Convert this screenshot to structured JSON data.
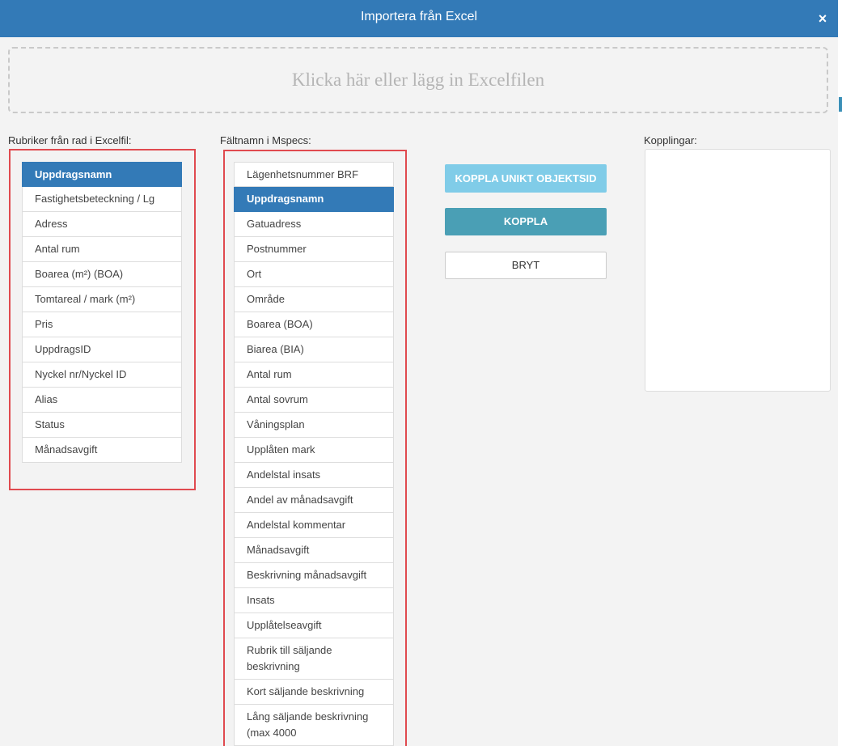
{
  "dialog": {
    "title": "Importera från Excel",
    "close_icon": "×"
  },
  "dropzone": {
    "text": "Klicka här eller lägg in Excelfilen"
  },
  "excel_headers": {
    "label": "Rubriker från rad i Excelfil:",
    "selected_index": 0,
    "items": [
      "Uppdragsnamn",
      "Fastighetsbeteckning / Lg",
      "Adress",
      "Antal rum",
      "Boarea (m²) (BOA)",
      "Tomtareal / mark (m²)",
      "Pris",
      "UppdragsID",
      "Nyckel nr/Nyckel ID",
      "Alias",
      "Status",
      "Månadsavgift"
    ]
  },
  "mspecs_fields": {
    "label": "Fältnamn i Mspecs:",
    "selected_index": 1,
    "items": [
      "Lägenhetsnummer BRF",
      "Uppdragsnamn",
      "Gatuadress",
      "Postnummer",
      "Ort",
      "Område",
      "Boarea (BOA)",
      "Biarea (BIA)",
      "Antal rum",
      "Antal sovrum",
      "Våningsplan",
      "Upplåten mark",
      "Andelstal insats",
      "Andel av månadsavgift",
      "Andelstal kommentar",
      "Månadsavgift",
      "Beskrivning månadsavgift",
      "Insats",
      "Upplåtelseavgift",
      "Rubrik till säljande beskrivning",
      "Kort säljande beskrivning",
      "Lång säljande beskrivning (max 4000"
    ]
  },
  "actions": {
    "link_unique_label": "KOPPLA UNIKT OBJEKTSID",
    "link_label": "KOPPLA",
    "break_label": "BRYT"
  },
  "connections": {
    "label": "Kopplingar:",
    "items": []
  },
  "colors": {
    "header": "#337ab7",
    "selected": "#337ab7",
    "highlight_frame": "#e04a4f",
    "link_unique_button": "#80cce8",
    "link_button": "#4a9fb5"
  }
}
